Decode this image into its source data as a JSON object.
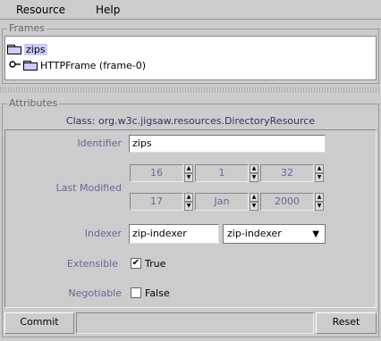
{
  "menu": {
    "resource": "Resource",
    "help": "Help"
  },
  "frames": {
    "title": "Frames",
    "root": {
      "label": "zips",
      "icon": "folder-icon"
    },
    "child": {
      "label": "HTTPFrame (frame-0)",
      "handle_icon": "tree-handle-icon",
      "icon": "folder-icon"
    }
  },
  "attributes": {
    "title": "Attributes",
    "class_line": "Class: org.w3c.jigsaw.resources.DirectoryResource",
    "identifier": {
      "label": "Identifier",
      "value": "zips"
    },
    "last_modified": {
      "label": "Last Modified",
      "hour": "16",
      "minute": "1",
      "second": "32",
      "day": "17",
      "month": "Jan",
      "year": "2000"
    },
    "indexer": {
      "label": "Indexer",
      "value": "zip-indexer",
      "selected": "zip-indexer"
    },
    "extensible": {
      "label": "Extensible",
      "value": "True",
      "checked": true,
      "check_glyph": "✔"
    },
    "negotiable": {
      "label": "Negotiable",
      "value": "False",
      "checked": false,
      "check_glyph": ""
    }
  },
  "footer": {
    "commit": "Commit",
    "reset": "Reset"
  },
  "colors": {
    "label": "#666699",
    "selection": "#ccccff",
    "panel": "#cccccc",
    "class_text": "#333366"
  }
}
